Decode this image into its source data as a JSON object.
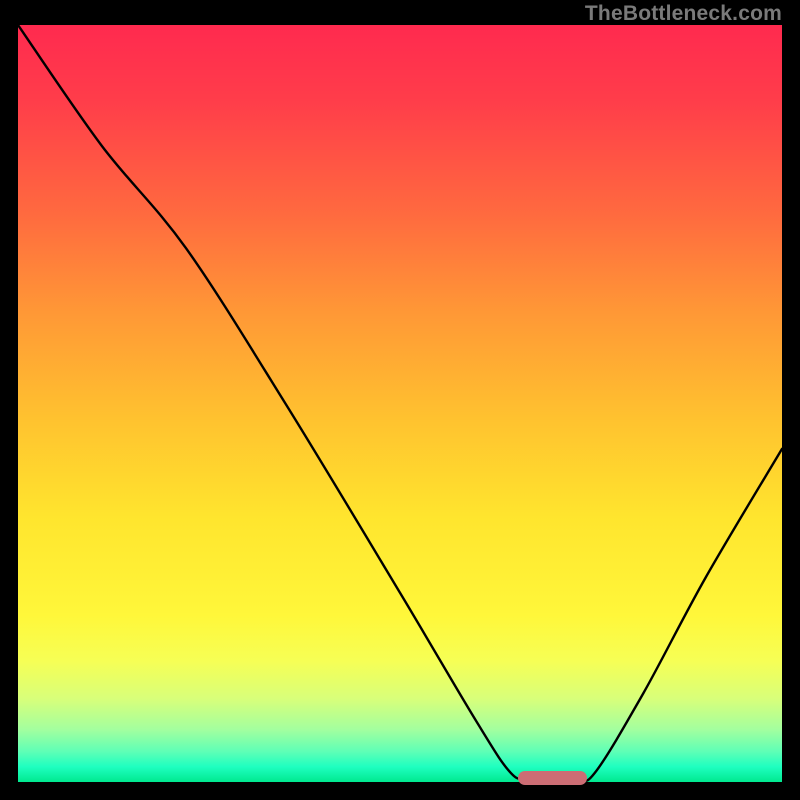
{
  "watermark": "TheBottleneck.com",
  "chart_data": {
    "type": "line",
    "title": "",
    "xlabel": "",
    "ylabel": "",
    "xlim": [
      0,
      100
    ],
    "ylim": [
      0,
      100
    ],
    "grid": false,
    "series": [
      {
        "name": "bottleneck-curve",
        "points": [
          {
            "x": 0.0,
            "y": 100.0
          },
          {
            "x": 11.0,
            "y": 84.0
          },
          {
            "x": 22.0,
            "y": 70.5
          },
          {
            "x": 35.0,
            "y": 50.0
          },
          {
            "x": 50.0,
            "y": 25.0
          },
          {
            "x": 60.0,
            "y": 8.0
          },
          {
            "x": 64.5,
            "y": 1.2
          },
          {
            "x": 67.0,
            "y": 0.5
          },
          {
            "x": 73.0,
            "y": 0.5
          },
          {
            "x": 75.5,
            "y": 1.2
          },
          {
            "x": 82.0,
            "y": 12.0
          },
          {
            "x": 90.0,
            "y": 27.0
          },
          {
            "x": 100.0,
            "y": 44.0
          }
        ]
      }
    ],
    "optimal_marker": {
      "x_start": 65.5,
      "x_end": 74.5,
      "y": 0.5
    }
  }
}
